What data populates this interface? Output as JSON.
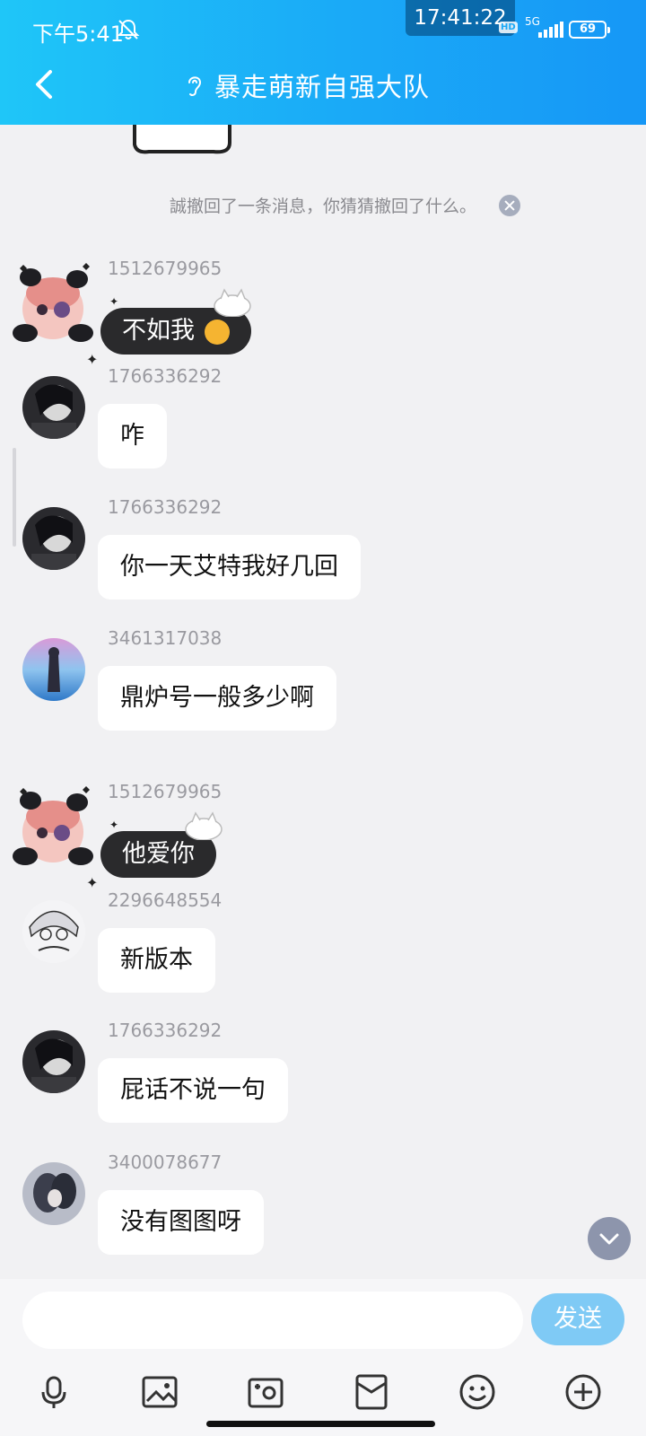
{
  "status_bar": {
    "time": "下午5:41",
    "recording_time": "17:41:22",
    "hd": "HD",
    "network": "5G",
    "battery": "69"
  },
  "header": {
    "title": "暴走萌新自强大队",
    "back_icon": "chevron-left-icon",
    "mode_icon": "ear-icon"
  },
  "recall_notice": "誠撤回了一条消息，你猜猜撤回了什么。",
  "messages": [
    {
      "uid": "1512679965",
      "text": "不如我",
      "style": "sticker-bubble"
    },
    {
      "uid": "1766336292",
      "text": "咋",
      "style": "plain"
    },
    {
      "uid": "1766336292",
      "text": "你一天艾特我好几回",
      "style": "plain"
    },
    {
      "uid": "3461317038",
      "text": "鼎炉号一般多少啊",
      "style": "plain"
    },
    {
      "uid": "1512679965",
      "text": "他爱你",
      "style": "sticker-bubble"
    },
    {
      "uid": "2296648554",
      "text": "新版本",
      "style": "plain"
    },
    {
      "uid": "1766336292",
      "text": "屁话不说一句",
      "style": "plain"
    },
    {
      "uid": "3400078677",
      "text": "没有图图呀",
      "style": "plain"
    }
  ],
  "input": {
    "placeholder": "",
    "send_label": "发送"
  },
  "toolbar": [
    "microphone-icon",
    "image-icon",
    "camera-icon",
    "red-packet-icon",
    "emoji-icon",
    "plus-icon"
  ],
  "colors": {
    "header_start": "#1fc6f8",
    "header_end": "#1697f6",
    "send_button": "#7fcaf5",
    "chat_bg": "#f1f1f3"
  }
}
